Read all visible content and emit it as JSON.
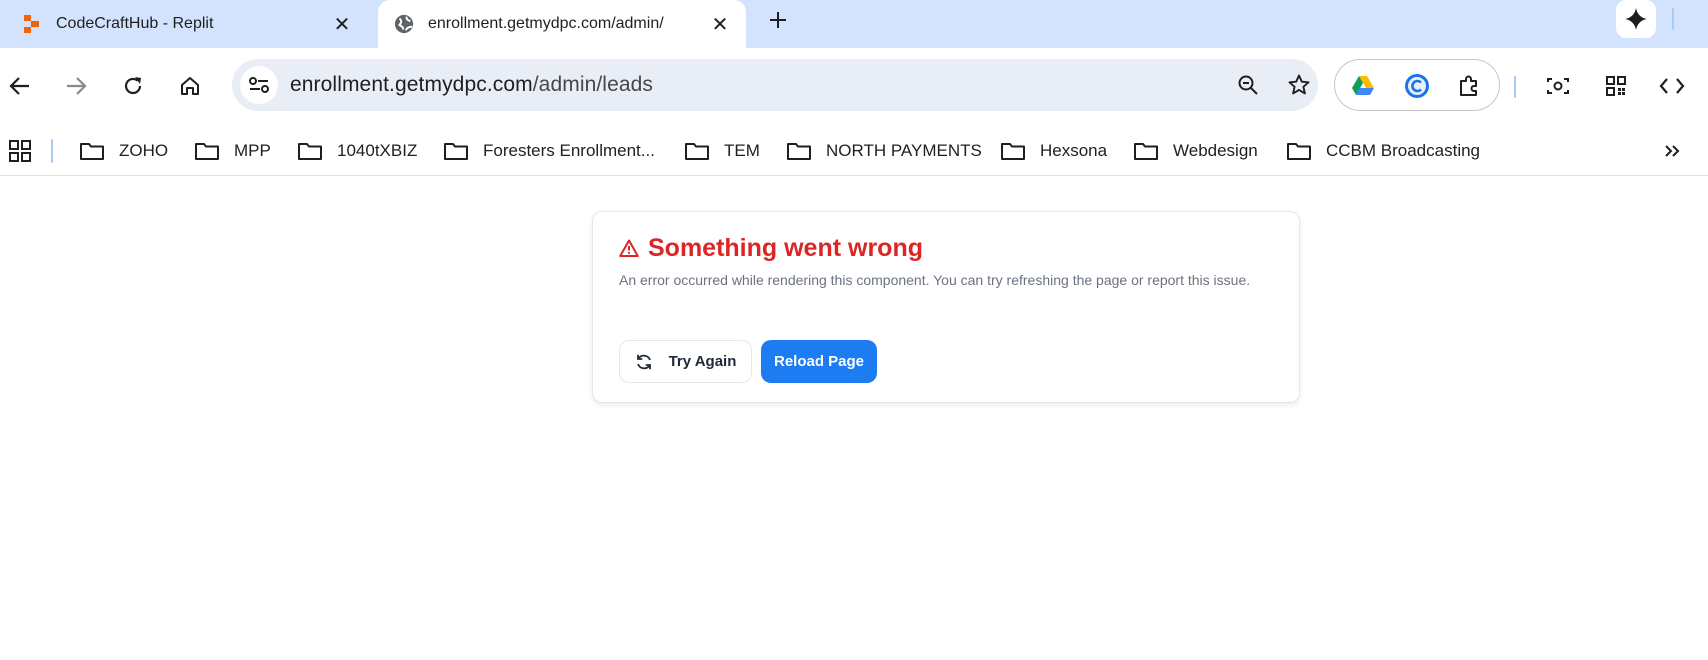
{
  "browser": {
    "tabs": [
      {
        "title": "CodeCraftHub - Replit",
        "favicon": "replit-logo",
        "active": false
      },
      {
        "title": "enrollment.getmydpc.com/admin/",
        "favicon": "globe-icon",
        "active": true
      }
    ],
    "new_tab_icon": "plus-icon",
    "gemini_icon": "sparkle-icon",
    "address_bar": {
      "url_host": "enrollment.getmydpc.com",
      "url_path": "/admin/leads"
    },
    "extensions": [
      "google-drive-icon",
      "cloud-c-icon",
      "puzzle-icon"
    ],
    "toolbar_icons": [
      "back-icon",
      "forward-icon",
      "reload-icon",
      "home-icon",
      "zoom-icon",
      "star-icon",
      "screenshot-icon",
      "qr-code-icon",
      "code-icon"
    ]
  },
  "bookmarks": {
    "items": [
      {
        "label": "ZOHO"
      },
      {
        "label": "MPP"
      },
      {
        "label": "1040tXBIZ"
      },
      {
        "label": "Foresters Enrollment..."
      },
      {
        "label": "TEM"
      },
      {
        "label": "NORTH PAYMENTS"
      },
      {
        "label": "Hexsona"
      },
      {
        "label": "Webdesign"
      },
      {
        "label": "CCBM Broadcasting"
      }
    ]
  },
  "error": {
    "title": "Something went wrong",
    "message": "An error occurred while rendering this component. You can try refreshing the page or report this issue.",
    "try_again_label": "Try Again",
    "reload_label": "Reload Page"
  },
  "colors": {
    "tabstrip": "#d3e3fd",
    "error_red": "#dc2626",
    "primary_blue": "#1d7cf2",
    "muted_text": "#6b7280"
  }
}
